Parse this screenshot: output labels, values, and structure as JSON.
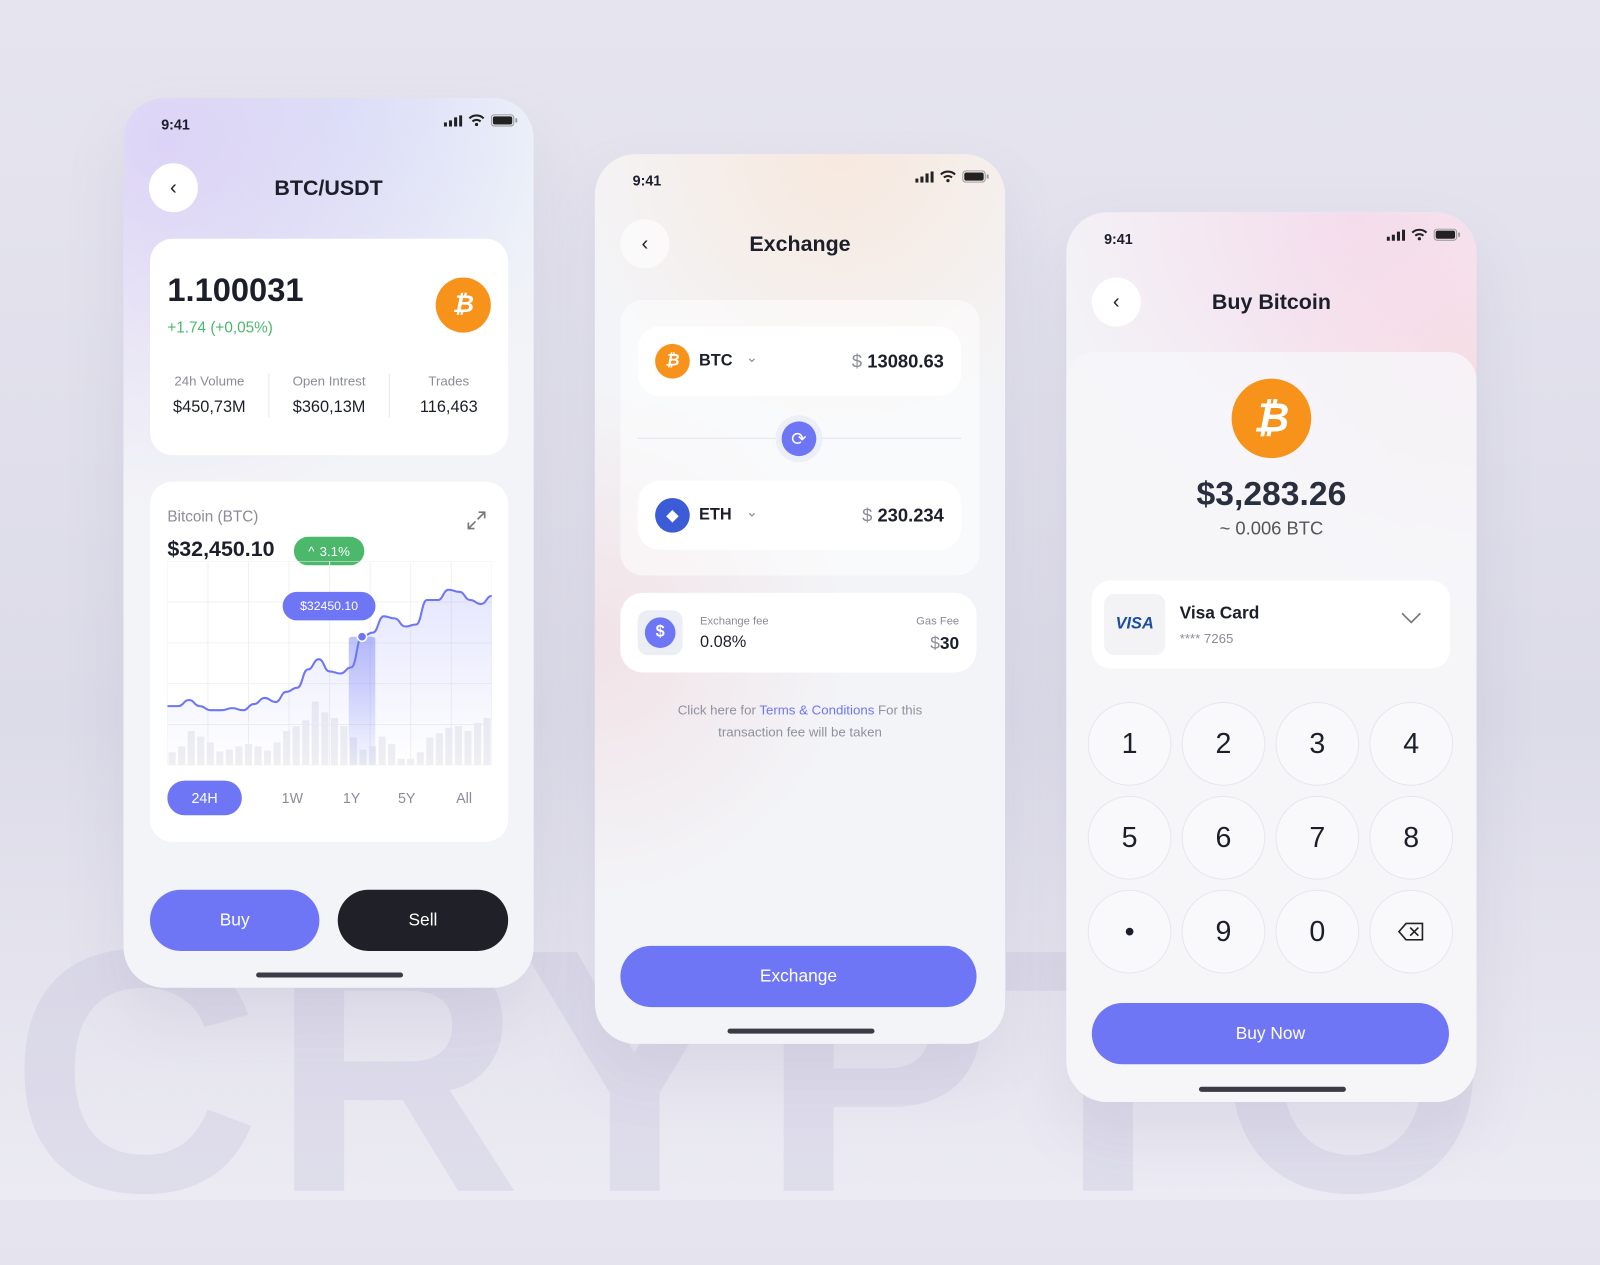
{
  "background_word": "CRYPTO",
  "colors": {
    "accent": "#6e76f5",
    "bitcoin": "#f7931a",
    "positive": "#4cb86b",
    "dark": "#1f2028",
    "eth": "#3c5bd6"
  },
  "status_bar": {
    "time": "9:41",
    "icons": [
      "signal-icon",
      "wifi-icon",
      "battery-icon"
    ]
  },
  "screen1": {
    "title": "BTC/USDT",
    "balance": "1.100031",
    "change": "+1.74 (+0,05%)",
    "stats": [
      {
        "label": "24h Volume",
        "value": "$450,73M"
      },
      {
        "label": "Open Intrest",
        "value": "$360,13M"
      },
      {
        "label": "Trades",
        "value": "116,463"
      }
    ],
    "chart_card": {
      "name": "Bitcoin (BTC)",
      "price": "$32,450.10",
      "badge": "3.1%",
      "tooltip": "$32450.10",
      "ranges": [
        "24H",
        "1W",
        "1Y",
        "5Y",
        "All"
      ],
      "active_range": "24H"
    },
    "buy_label": "Buy",
    "sell_label": "Sell"
  },
  "chart_data": {
    "type": "line",
    "title": "",
    "grid": true,
    "line_values": [
      29,
      29,
      32,
      29,
      27,
      27,
      28,
      27,
      30,
      33,
      31,
      36,
      38,
      47,
      52,
      46,
      45,
      48,
      63,
      65,
      73,
      72,
      68,
      69,
      81,
      81,
      86,
      85,
      81,
      79,
      83
    ],
    "selected_index": 18,
    "volume_values": [
      40,
      58,
      105,
      88,
      70,
      42,
      48,
      58,
      65,
      58,
      45,
      70,
      105,
      120,
      138,
      195,
      162,
      145,
      120,
      85,
      48,
      58,
      88,
      65,
      20,
      20,
      40,
      85,
      98,
      115,
      120,
      105,
      130,
      145
    ]
  },
  "screen2": {
    "title": "Exchange",
    "from": {
      "symbol": "BTC",
      "currency": "$",
      "amount": "13080.63"
    },
    "to": {
      "symbol": "ETH",
      "currency": "$",
      "amount": "230.234"
    },
    "fee_label": "Exchange fee",
    "fee_value": "0.08%",
    "gas_label": "Gas Fee",
    "gas_currency": "$",
    "gas_value": "30",
    "terms_prefix": "Click here for ",
    "terms_link": "Terms & Conditions",
    "terms_suffix": " For this transaction fee will be taken",
    "button": "Exchange"
  },
  "screen3": {
    "title": "Buy Bitcoin",
    "amount": "$3,283.26",
    "btc_amount": "~ 0.006 BTC",
    "card_brand": "VISA",
    "card_name": "Visa Card",
    "card_number": "**** 7265",
    "keys": [
      "1",
      "2",
      "3",
      "4",
      "5",
      "6",
      "7",
      "8",
      "•",
      "9",
      "0",
      "backspace"
    ],
    "button": "Buy Now"
  }
}
